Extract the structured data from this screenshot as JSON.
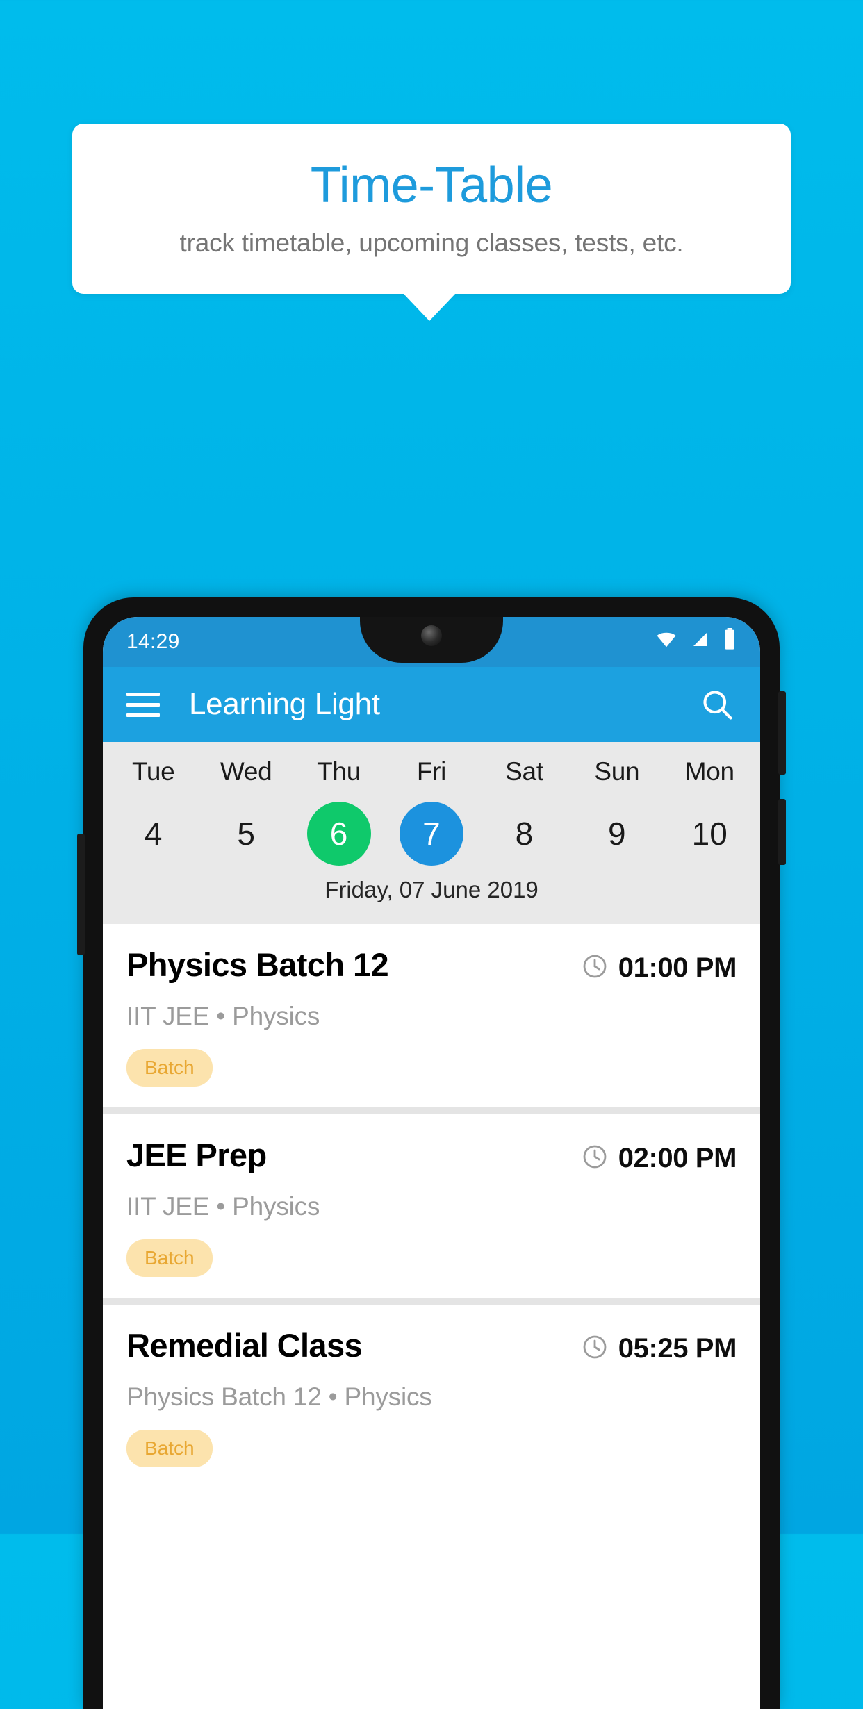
{
  "promo": {
    "title": "Time-Table",
    "subtitle": "track timetable, upcoming classes, tests, etc.",
    "title_color": "#1E9BDC",
    "subtitle_color": "#757575",
    "background_color": "#00B4E8"
  },
  "phone": {
    "statusbar": {
      "time": "14:29",
      "icons": [
        "wifi-icon",
        "signal-icon",
        "battery-icon"
      ],
      "background_color": "#1F92D1"
    },
    "appbar": {
      "menu_icon": "hamburger-menu-icon",
      "title": "Learning Light",
      "search_icon": "search-icon",
      "background_color": "#1CA1E0"
    },
    "week": {
      "background_color": "#E9E9E9",
      "days": [
        {
          "name": "Tue",
          "num": "4",
          "state": "normal"
        },
        {
          "name": "Wed",
          "num": "5",
          "state": "normal"
        },
        {
          "name": "Thu",
          "num": "6",
          "state": "today"
        },
        {
          "name": "Fri",
          "num": "7",
          "state": "selected"
        },
        {
          "name": "Sat",
          "num": "8",
          "state": "normal"
        },
        {
          "name": "Sun",
          "num": "9",
          "state": "normal"
        },
        {
          "name": "Mon",
          "num": "10",
          "state": "normal"
        }
      ],
      "today_color": "#0FC96B",
      "selected_color": "#1C92DE",
      "date_label": "Friday, 07 June 2019"
    },
    "classes": [
      {
        "title": "Physics Batch 12",
        "time": "01:00 PM",
        "clock_icon": "clock-icon",
        "subtitle": "IIT JEE • Physics",
        "badge": "Batch"
      },
      {
        "title": "JEE Prep",
        "time": "02:00 PM",
        "clock_icon": "clock-icon",
        "subtitle": "IIT JEE • Physics",
        "badge": "Batch"
      },
      {
        "title": "Remedial Class",
        "time": "05:25 PM",
        "clock_icon": "clock-icon",
        "subtitle": "Physics Batch 12 • Physics",
        "badge": "Batch"
      }
    ],
    "badge_bg_color": "#FCE3AD",
    "badge_text_color": "#E8A732"
  }
}
